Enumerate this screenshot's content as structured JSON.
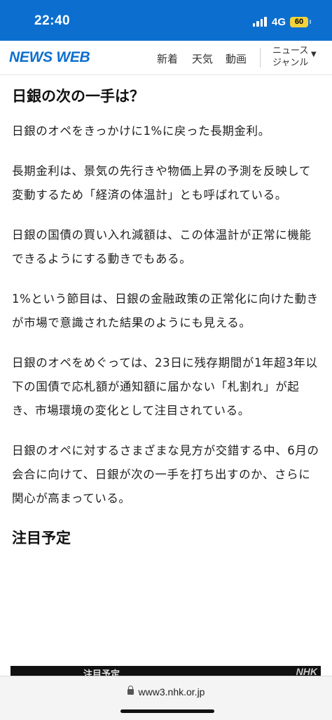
{
  "status_bar": {
    "time": "22:40",
    "network": "4G",
    "battery": "60",
    "signal_icon": "signal-bars-icon",
    "battery_icon": "battery-icon"
  },
  "header": {
    "logo": "NEWS WEB",
    "nav": [
      "新着",
      "天気",
      "動画"
    ],
    "genre_line1": "ニュース",
    "genre_line2": "ジャンル",
    "genre_icon": "triangle-down-icon"
  },
  "article": {
    "heading": "日銀の次の一手は？",
    "paragraphs": [
      "日銀のオペをきっかけに1%に戻った長期金利。",
      "長期金利は、景気の先行きや物価上昇の予測を反映して変動するため「経済の体温計」とも呼ばれている。",
      "日銀の国債の買い入れ減額は、この体温計が正常に機能できるようにする動きでもある。",
      "1%という節目は、日銀の金融政策の正常化に向けた動きが市場で意識された結果のようにも見える。",
      "日銀のオペをめぐっては、23日に残存期間が1年超3年以下の国債で応札額が通知額に届かない「札割れ」が起き、市場環境の変化として注目されている。",
      "日銀のオペに対するさまざまな見方が交錯する中、6月の会合に向けて、日銀が次の一手を打ち出すのか、さらに関心が高まっている。"
    ],
    "section_heading": "注目予定"
  },
  "video": {
    "label": "注目予定",
    "watermark": "NHK"
  },
  "browser": {
    "url": "www3.nhk.or.jp",
    "lock_icon": "lock-icon"
  },
  "colors": {
    "brand_blue": "#0c6fcf",
    "battery_yellow": "#f3d33b"
  }
}
